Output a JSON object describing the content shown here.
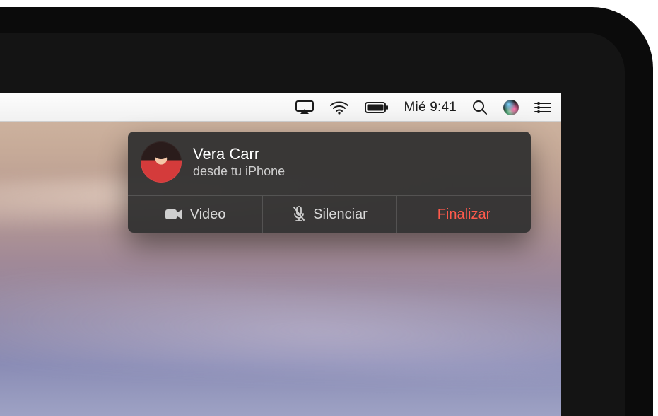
{
  "menubar": {
    "clock": "Mié 9:41"
  },
  "call": {
    "name": "Vera Carr",
    "subtitle": "desde tu iPhone",
    "buttons": {
      "video": "Video",
      "mute": "Silenciar",
      "end": "Finalizar"
    }
  },
  "colors": {
    "end_call": "#ff5a4c"
  }
}
